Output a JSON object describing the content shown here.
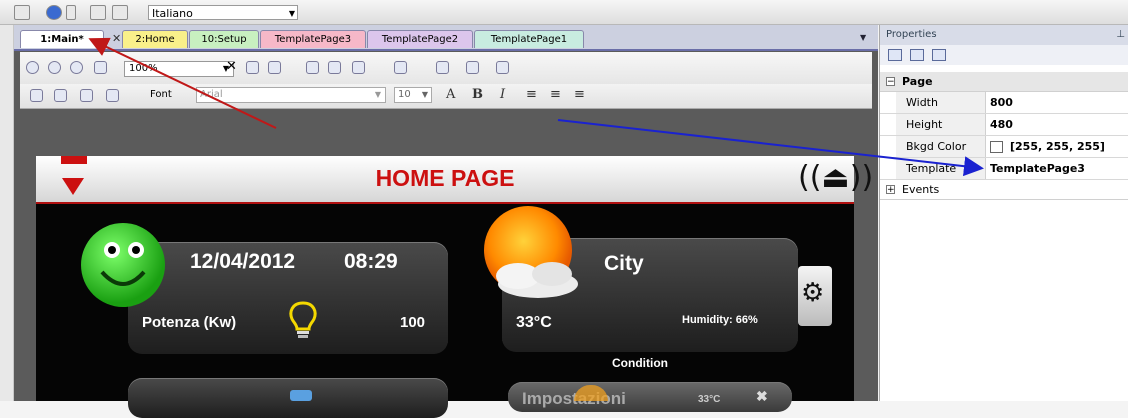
{
  "toolbar": {
    "language": "Italiano"
  },
  "tabs": [
    {
      "label": "1:Main*",
      "color": "#ffffff"
    },
    {
      "label": "2:Home",
      "color": "#f9f08a"
    },
    {
      "label": "10:Setup",
      "color": "#c8f0c0"
    },
    {
      "label": "TemplatePage3",
      "color": "#f6b8c8"
    },
    {
      "label": "TemplatePage2",
      "color": "#dcc6ec"
    },
    {
      "label": "TemplatePage1",
      "color": "#c8ece0"
    }
  ],
  "editor": {
    "zoom": "100%",
    "font_label": "Font",
    "font_family": "Arial",
    "font_size": "10",
    "bold_label": "B",
    "italic_label": "I",
    "text_big_a": "A"
  },
  "hmi": {
    "page_title": "HOME PAGE",
    "date": "12/04/2012",
    "time": "08:29",
    "power_label": "Potenza (Kw)",
    "power_value": "100",
    "temperature": "33°C",
    "humidity": "Humidity: 66%",
    "city": "City",
    "condition_label": "Condition",
    "settings_label": "Impostazioni",
    "mini_temp": "33°C",
    "brand_color": "#cc1010"
  },
  "properties": {
    "title": "Properties",
    "group_page": "Page",
    "rows": [
      {
        "label": "Width",
        "value": "800"
      },
      {
        "label": "Height",
        "value": "480"
      },
      {
        "label": "Bkgd Color",
        "value": "[255, 255, 255]"
      },
      {
        "label": "Template",
        "value": "TemplatePage3"
      }
    ],
    "group_events": "Events"
  }
}
